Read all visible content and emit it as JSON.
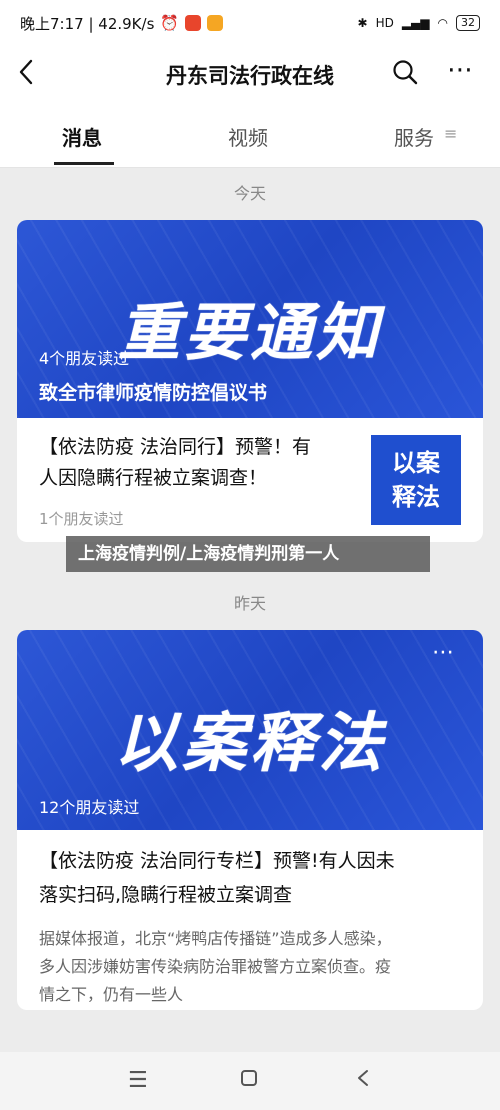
{
  "status": {
    "time_text": "晚上7:17 | 42.9K/s",
    "battery": "32",
    "network": "HD"
  },
  "header": {
    "title": "丹东司法行政在线"
  },
  "tabs": [
    {
      "label": "消息"
    },
    {
      "label": "视频"
    },
    {
      "label": "服务"
    }
  ],
  "feed": {
    "date_today": "今天",
    "date_yesterday": "昨天",
    "card1": {
      "banner_text": "重要通知",
      "banner_friends": "4个朋友读过",
      "banner_caption": "致全市律师疫情防控倡议书",
      "body_title_line1": "【依法防疫 法治同行】预警！有",
      "body_title_line2": "人因隐瞒行程被立案调查！",
      "friends_read": "1个朋友读过",
      "thumb_line1": "以案",
      "thumb_line2": "释法"
    },
    "card2": {
      "banner_text": "以案释法",
      "banner_friends": "12个朋友读过",
      "body_title_line1": "【依法防疫 法治同行专栏】预警!有人因未",
      "body_title_line2": "落实扫码,隐瞒行程被立案调查",
      "snippet_line1": "据媒体报道，北京“烤鸭店传播链”造成多人感染，",
      "snippet_line2": "多人因涉嫌妨害传染病防治罪被警方立案侦查。疫",
      "snippet_line3": "情之下，仍有一些人"
    }
  },
  "overlay": {
    "title": "上海疫情判例/上海疫情判刑第一人"
  },
  "colors": {
    "banner_blue": "#2552d4",
    "thumb_blue": "#1f4fcf"
  },
  "icons": [
    "back-icon",
    "search-icon",
    "more-icon",
    "menu-icon",
    "home-icon",
    "nav-back-icon"
  ]
}
